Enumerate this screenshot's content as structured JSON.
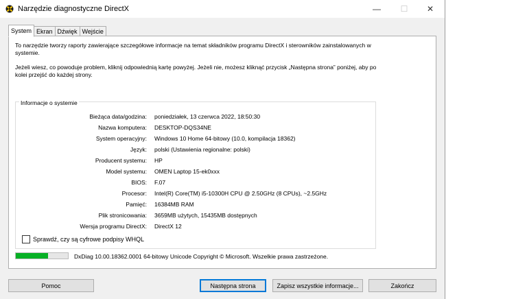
{
  "window": {
    "title": "Narzędzie diagnostyczne DirectX"
  },
  "controls": {
    "minimize": "—",
    "maximize": "☐",
    "close": "✕"
  },
  "tabs": [
    {
      "label": "System",
      "active": true
    },
    {
      "label": "Ekran",
      "active": false
    },
    {
      "label": "Dźwięk",
      "active": false
    },
    {
      "label": "Wejście",
      "active": false
    }
  ],
  "intro": {
    "p1": "To narzędzie tworzy raporty zawierające szczegółowe informacje na temat składników programu DirectX i sterowników zainstalowanych w systemie.",
    "p2": "Jeżeli wiesz, co powoduje problem, kliknij odpowiednią kartę powyżej. Jeżeli nie, możesz kliknąć przycisk „Następna strona” poniżej, aby po kolei przejść do każdej strony."
  },
  "system_info": {
    "title": "Informacje o systemie",
    "rows": [
      {
        "label": "Bieżąca data/godzina:",
        "value": "poniedziałek, 13 czerwca 2022, 18:50:30"
      },
      {
        "label": "Nazwa komputera:",
        "value": "DESKTOP-DQS34NE"
      },
      {
        "label": "System operacyjny:",
        "value": "Windows 10 Home 64-bitowy (10.0, kompilacja 18362)"
      },
      {
        "label": "Język:",
        "value": "polski (Ustawienia regionalne: polski)"
      },
      {
        "label": "Producent systemu:",
        "value": "HP"
      },
      {
        "label": "Model systemu:",
        "value": "OMEN Laptop 15-ek0xxx"
      },
      {
        "label": "BIOS:",
        "value": "F.07"
      },
      {
        "label": "Procesor:",
        "value": "Intel(R) Core(TM) i5-10300H CPU @ 2.50GHz (8 CPUs), ~2.5GHz"
      },
      {
        "label": "Pamięć:",
        "value": "16384MB RAM"
      },
      {
        "label": "Plik stronicowania:",
        "value": "3659MB użytych, 15435MB dostępnych"
      },
      {
        "label": "Wersja programu DirectX:",
        "value": "DirectX 12"
      }
    ]
  },
  "whql_checkbox": {
    "label": "Sprawdź, czy są cyfrowe podpisy WHQL",
    "checked": false
  },
  "progress": {
    "fraction": 0.62,
    "color": "#06b025"
  },
  "status_text": "DxDiag 10.00.18362.0001 64-bitowy Unicode  Copyright © Microsoft. Wszelkie prawa zastrzeżone.",
  "buttons": {
    "help": "Pomoc",
    "next": "Następna strona",
    "save": "Zapisz wszystkie informacje...",
    "exit": "Zakończ"
  }
}
